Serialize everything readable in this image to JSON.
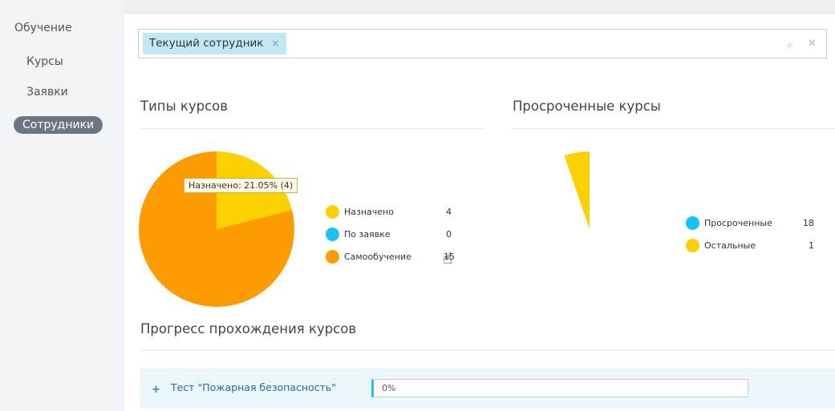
{
  "sidebar": {
    "heading": "Обучение",
    "items": [
      {
        "label": "Курсы"
      },
      {
        "label": "Заявки"
      },
      {
        "label": "Сотрудники",
        "active": true
      }
    ]
  },
  "search": {
    "tag": "Текущий сотрудник",
    "tag_close": "×",
    "search_icon": "⌕",
    "clear_icon": "✕"
  },
  "course_types": {
    "title": "Типы курсов",
    "tooltip": "Назначено: 21.05% (4)",
    "legend": [
      {
        "label": "Назначено",
        "value": "4",
        "color": "#fdd000"
      },
      {
        "label": "По заявке",
        "value": "0",
        "color": "#1ec0f5"
      },
      {
        "label": "Самообучение",
        "value": "15",
        "color": "#fd9b00"
      }
    ]
  },
  "overdue": {
    "title": "Просроченные курсы",
    "legend": [
      {
        "label": "Просроченные",
        "value": "18",
        "color": "#12c3f5"
      },
      {
        "label": "Остальные",
        "value": "1",
        "color": "#fdd000"
      }
    ]
  },
  "progress": {
    "title": "Прогресс прохождения курсов",
    "items": [
      {
        "label": "Тест \"Пожарная безопасность\"",
        "percent": "0%",
        "value": 0
      }
    ]
  }
}
